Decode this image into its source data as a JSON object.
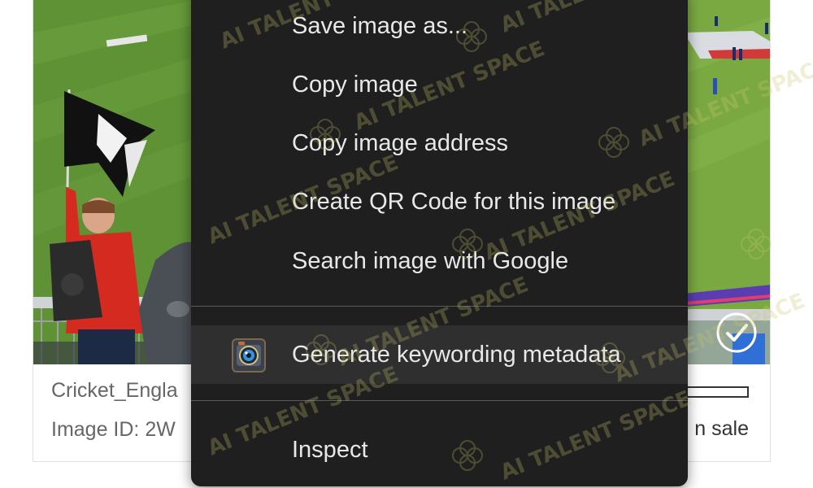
{
  "left_card": {
    "caption_title": "Cricket_Engla",
    "caption_id": "Image ID: 2W"
  },
  "right_card": {
    "sale_text": "n sale"
  },
  "context_menu": {
    "items": [
      {
        "label": "Save image as..."
      },
      {
        "label": "Copy image"
      },
      {
        "label": "Copy image address"
      },
      {
        "label": "Create QR Code for this image"
      },
      {
        "label": "Search image with Google"
      },
      {
        "label": "Generate keywording metadata"
      },
      {
        "label": "Inspect"
      }
    ]
  },
  "watermark": {
    "text": "AI TALENT SPACE"
  },
  "colors": {
    "menu_bg": "#1f1f1f",
    "menu_highlight": "#2f2f2f",
    "menu_text": "#e8e8e8",
    "caption_text": "#666666",
    "watermark": "#c9c56a"
  }
}
